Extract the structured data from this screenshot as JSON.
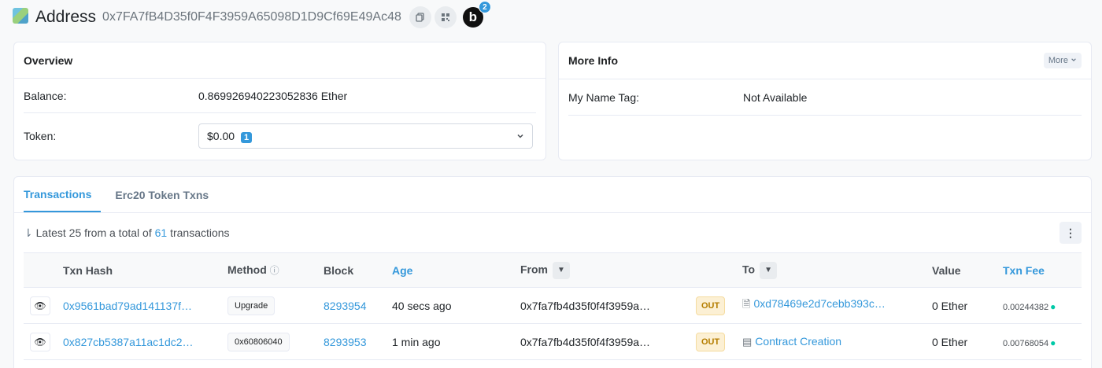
{
  "header": {
    "title": "Address",
    "address": "0x7FA7fB4D35f0F4F3959A65098D1D9Cf69E49Ac48",
    "copy_icon": "copy-icon",
    "qr_icon": "qr-code-icon",
    "blockscan_label": "b",
    "blockscan_count": "2"
  },
  "overview": {
    "title": "Overview",
    "balance_label": "Balance:",
    "balance_value": "0.869926940223052836 Ether",
    "token_label": "Token:",
    "token_value": "$0.00",
    "token_count": "1"
  },
  "more_info": {
    "title": "More Info",
    "more_button": "More",
    "name_tag_label": "My Name Tag:",
    "name_tag_value": "Not Available"
  },
  "tabs": [
    {
      "label": "Transactions",
      "active": true
    },
    {
      "label": "Erc20 Token Txns",
      "active": false
    }
  ],
  "summary": {
    "prefix": "Latest 25 from a total of",
    "total": "61",
    "suffix": "transactions"
  },
  "table": {
    "columns": [
      "Txn Hash",
      "Method",
      "Block",
      "Age",
      "From",
      "To",
      "Value",
      "Txn Fee"
    ],
    "rows": [
      {
        "hash": "0x9561bad79ad141137f…",
        "method": "Upgrade",
        "block": "8293954",
        "age": "40 secs ago",
        "from": "0x7fa7fb4d35f0f4f3959a…",
        "direction": "OUT",
        "to": "0xd78469e2d7cebb393c…",
        "value": "0 Ether",
        "fee": "0.00244382"
      },
      {
        "hash": "0x827cb5387a11ac1dc2…",
        "method": "0x60806040",
        "block": "8293953",
        "age": "1 min ago",
        "from": "0x7fa7fb4d35f0f4f3959a…",
        "direction": "OUT",
        "to": "Contract Creation",
        "value": "0 Ether",
        "fee": "0.00768054"
      }
    ]
  },
  "colors": {
    "accent": "#3498db",
    "out_badge": "#fcf0d4"
  }
}
